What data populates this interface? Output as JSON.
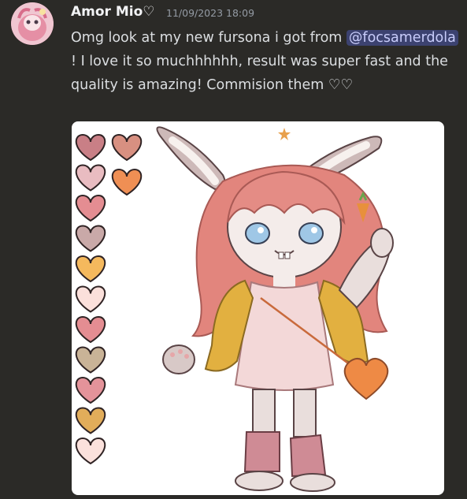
{
  "message": {
    "author": "Amor Mio♡",
    "timestamp": "11/09/2023 18:09",
    "text_before": "Omg look at my new fursona i got from ",
    "mention": "@focsamerdola",
    "text_after": " ! I love it so muchhhhhh, result was super fast and the quality is amazing! Commision them ♡♡"
  },
  "attachment": {
    "palette_left": [
      "#c97f86",
      "#e9bcc1",
      "#e48d92",
      "#c9a9a8",
      "#f5b95d",
      "#fbe0db",
      "#e48d92",
      "#c9b397",
      "#e4939a",
      "#e2ad5a",
      "#fbe1dc"
    ],
    "palette_right": [
      "#d89081",
      "#ef8f54"
    ]
  }
}
